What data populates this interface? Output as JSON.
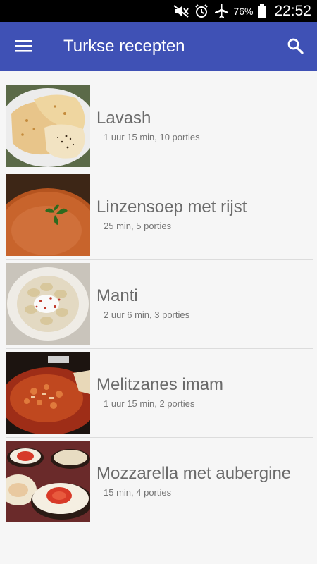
{
  "status_bar": {
    "battery_percent": "76%",
    "time": "22:52",
    "icons": [
      "mute-icon",
      "alarm-icon",
      "airplane-icon",
      "battery-icon"
    ]
  },
  "toolbar": {
    "title": "Turkse recepten",
    "menu_icon": "hamburger-menu-icon",
    "search_icon": "search-icon",
    "color": "#3f51b5"
  },
  "recipes": [
    {
      "title": "Lavash",
      "subtitle": "1 uur 15 min, 10 porties"
    },
    {
      "title": "Linzensoep met rijst",
      "subtitle": "25 min, 5 porties"
    },
    {
      "title": "Manti",
      "subtitle": "2 uur 6 min, 3 porties"
    },
    {
      "title": "Melitzanes imam",
      "subtitle": "1 uur 15 min, 2 porties"
    },
    {
      "title": "Mozzarella met aubergine",
      "subtitle": "15 min, 4 porties"
    }
  ]
}
